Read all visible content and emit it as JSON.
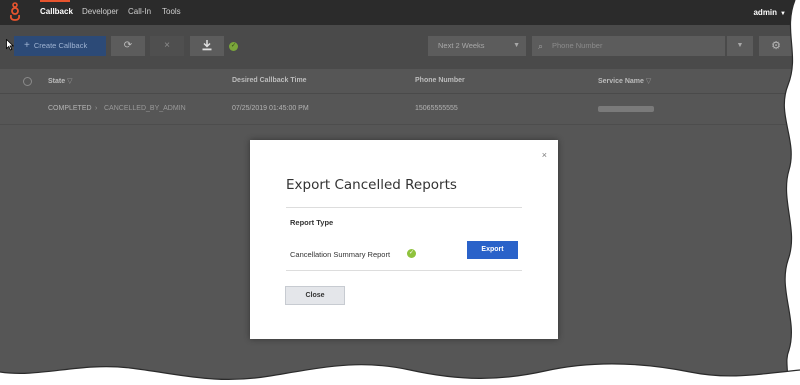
{
  "nav": {
    "items": [
      {
        "label": "Callback",
        "active": true
      },
      {
        "label": "Developer",
        "active": false
      },
      {
        "label": "Call-In",
        "active": false
      },
      {
        "label": "Tools",
        "active": false
      }
    ],
    "user_label": "admin",
    "accent_color": "#e7542e"
  },
  "toolbar": {
    "create_label": "Create Callback",
    "date_range": "Next 2 Weeks",
    "search_placeholder": "Phone Number"
  },
  "table": {
    "headers": [
      "State",
      "Desired Callback Time",
      "Phone Number",
      "Service Name"
    ],
    "rows": [
      {
        "state": "COMPLETED",
        "sub_state": "CANCELLED_BY_ADMIN",
        "time": "07/25/2019 01:45:00 PM",
        "phone": "15065555555"
      }
    ]
  },
  "modal": {
    "title": "Export Cancelled Reports",
    "section_label": "Report Type",
    "report_name": "Cancellation Summary Report",
    "export_label": "Export",
    "close_label": "Close",
    "close_icon": "×",
    "primary_color": "#2a62c9",
    "success_color": "#8fc23d"
  }
}
